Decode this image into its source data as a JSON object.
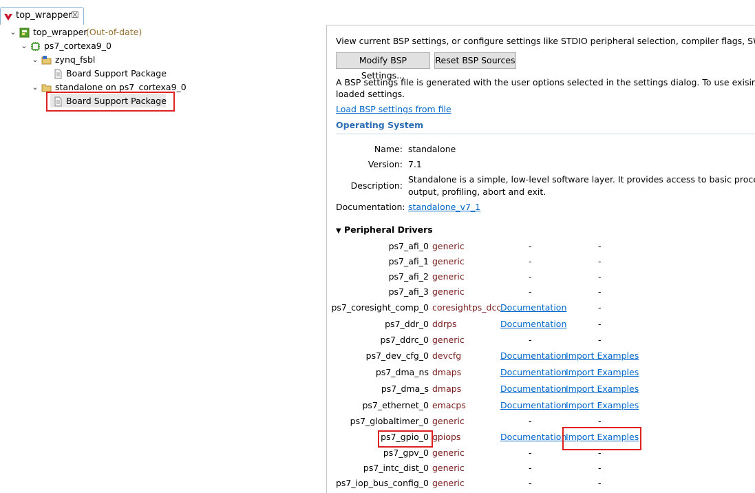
{
  "tab": {
    "title": "top_wrapper",
    "close": "☒"
  },
  "tree": {
    "root": {
      "label": "top_wrapper",
      "status": "(Out-of-date)"
    },
    "processor": "ps7_cortexa9_0",
    "fsbl": "zynq_fsbl",
    "fsbl_bsp": "Board Support Package",
    "standalone": "standalone on ps7_cortexa9_0",
    "standalone_bsp": "Board Support Package"
  },
  "bsp": {
    "intro": "View current BSP settings, or configure settings like STDIO peripheral selection, compiler flags, SW intrus",
    "modify_button": "Modify BSP Settings...",
    "reset_button": "Reset BSP Sources",
    "info_line1": "A BSP settings file is generated with the user options selected in the settings dialog. To use exising settin",
    "info_line2": "loaded settings.",
    "load_link": "Load BSP settings from file"
  },
  "os": {
    "section_title": "Operating System",
    "name_label": "Name:",
    "name": "standalone",
    "version_label": "Version:",
    "version": "7.1",
    "description_label": "Description:",
    "description_line1": "Standalone is a simple, low-level software layer. It provides access to basic processor",
    "description_line2": "output, profiling, abort and exit.",
    "documentation_label": "Documentation:",
    "documentation_link": "standalone_v7_1"
  },
  "peripheral": {
    "header": "Peripheral Drivers",
    "rows": [
      {
        "name": "ps7_afi_0",
        "driver": "generic",
        "doc": "-",
        "examples": "-"
      },
      {
        "name": "ps7_afi_1",
        "driver": "generic",
        "doc": "-",
        "examples": "-"
      },
      {
        "name": "ps7_afi_2",
        "driver": "generic",
        "doc": "-",
        "examples": "-"
      },
      {
        "name": "ps7_afi_3",
        "driver": "generic",
        "doc": "-",
        "examples": "-"
      },
      {
        "name": "ps7_coresight_comp_0",
        "driver": "coresightps_dcc",
        "doc": "Documentation",
        "examples": "-"
      },
      {
        "name": "ps7_ddr_0",
        "driver": "ddrps",
        "doc": "Documentation",
        "examples": "-"
      },
      {
        "name": "ps7_ddrc_0",
        "driver": "generic",
        "doc": "-",
        "examples": "-"
      },
      {
        "name": "ps7_dev_cfg_0",
        "driver": "devcfg",
        "doc": "Documentation",
        "examples": "Import Examples"
      },
      {
        "name": "ps7_dma_ns",
        "driver": "dmaps",
        "doc": "Documentation",
        "examples": "Import Examples"
      },
      {
        "name": "ps7_dma_s",
        "driver": "dmaps",
        "doc": "Documentation",
        "examples": "Import Examples"
      },
      {
        "name": "ps7_ethernet_0",
        "driver": "emacps",
        "doc": "Documentation",
        "examples": "Import Examples"
      },
      {
        "name": "ps7_globaltimer_0",
        "driver": "generic",
        "doc": "-",
        "examples": "-"
      },
      {
        "name": "ps7_gpio_0",
        "driver": "gpiops",
        "doc": "Documentation",
        "examples": "Import Examples"
      },
      {
        "name": "ps7_gpv_0",
        "driver": "generic",
        "doc": "-",
        "examples": "-"
      },
      {
        "name": "ps7_intc_dist_0",
        "driver": "generic",
        "doc": "-",
        "examples": "-"
      },
      {
        "name": "ps7_iop_bus_config_0",
        "driver": "generic",
        "doc": "-",
        "examples": "-"
      }
    ]
  },
  "colors": {
    "highlight_box": "#e02020",
    "link": "#0066cc",
    "section_title": "#2a6db5",
    "driver_text": "#7a1c1c"
  }
}
